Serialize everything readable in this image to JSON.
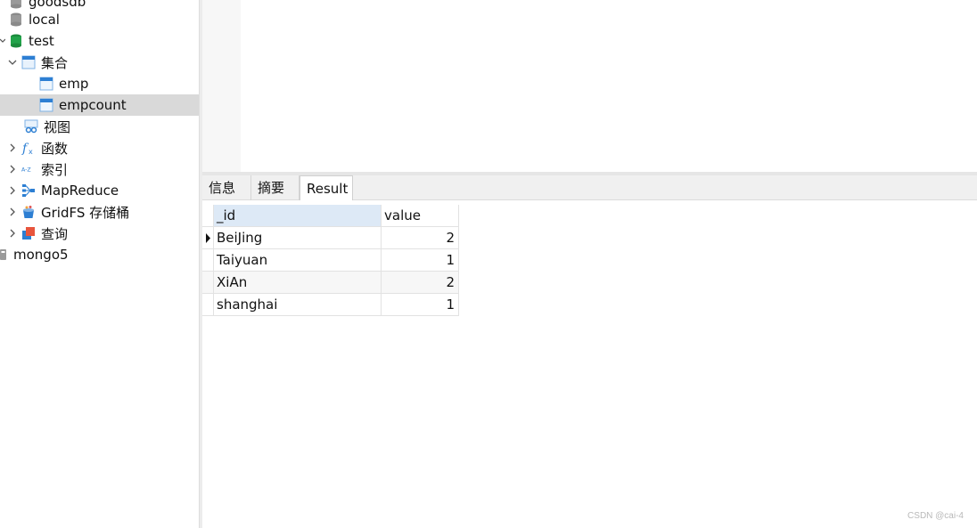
{
  "sidebar": {
    "items": [
      {
        "label": "goodsdb",
        "icon": "database-icon"
      },
      {
        "label": "local",
        "icon": "database-icon"
      },
      {
        "label": "test",
        "icon": "database-active-icon"
      },
      {
        "label": "集合",
        "icon": "collection-folder-icon"
      },
      {
        "label": "emp",
        "icon": "collection-icon"
      },
      {
        "label": "empcount",
        "icon": "collection-icon"
      },
      {
        "label": "视图",
        "icon": "view-icon"
      },
      {
        "label": "函数",
        "icon": "function-icon"
      },
      {
        "label": "索引",
        "icon": "index-icon"
      },
      {
        "label": "MapReduce",
        "icon": "mapreduce-icon"
      },
      {
        "label": "GridFS 存储桶",
        "icon": "gridfs-bucket-icon"
      },
      {
        "label": "查询",
        "icon": "query-icon"
      },
      {
        "label": "mongo5",
        "icon": "connection-icon"
      }
    ]
  },
  "tabs": [
    {
      "label": "信息"
    },
    {
      "label": "摘要"
    },
    {
      "label": "Result",
      "active": true
    }
  ],
  "grid": {
    "columns": [
      "_id",
      "value"
    ],
    "rows": [
      [
        "BeiJing",
        "2"
      ],
      [
        "Taiyuan",
        "1"
      ],
      [
        "XiAn",
        "2"
      ],
      [
        "shanghai",
        "1"
      ]
    ]
  },
  "watermark": "CSDN @cai-4",
  "colors": {
    "selected_row": "#d9d9d9",
    "selected_column_header": "#dde9f6",
    "db_active": "#22a34a",
    "collection_blue": "#2d7fd3"
  }
}
